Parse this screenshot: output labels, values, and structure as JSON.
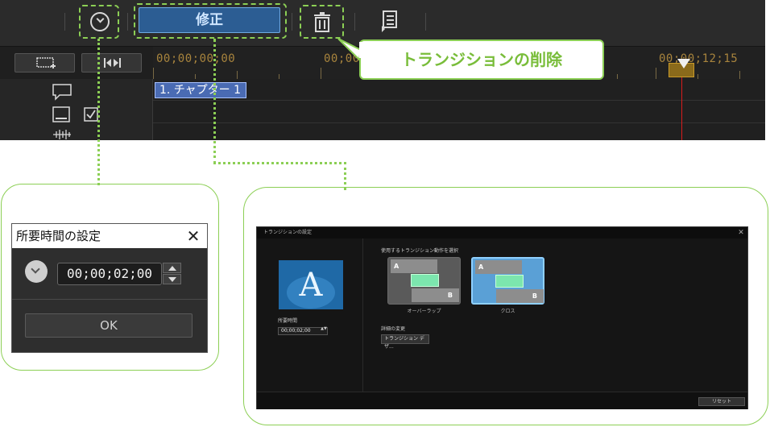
{
  "toolbar": {
    "fix_label": "修正"
  },
  "ruler": {
    "timecodes": [
      "00;00;00;00",
      "00;00",
      "00;00;12;15"
    ]
  },
  "tracks": {
    "chapter_clip": "1. チャプター 1"
  },
  "callout": {
    "text": "トランジションの削除"
  },
  "duration_dialog": {
    "title": "所要時間の設定",
    "close": "✕",
    "value": "00;00;02;00",
    "ok_label": "OK"
  },
  "transition_dialog": {
    "title": "トランジションの設定",
    "close": "✕",
    "preview_letter": "A",
    "duration_label": "所要時間",
    "duration_value": "00;00;02;00",
    "spin": "▲▼",
    "choose_label": "使用するトランジション動作を選択",
    "options": [
      {
        "a": "A",
        "b": "B",
        "label": "オーバーラップ"
      },
      {
        "a": "A",
        "b": "B",
        "label": "クロス"
      }
    ],
    "detail_label": "詳細の変更",
    "design_button": "トランジション デザ...",
    "reset_button": "リセット"
  },
  "colors": {
    "accent_green": "#8ccf55",
    "callout_text": "#79bd3a",
    "fix_button": "#2c5d93",
    "chapter_clip": "#4a6bb3",
    "playhead": "#d81c1c",
    "timecode": "#a8843d"
  },
  "icons": [
    "chevron-circle-icon",
    "trash-icon",
    "chapter-list-icon",
    "speech-bubble-icon",
    "subtitle-icon",
    "checkbox-icon",
    "audio-wave-icon",
    "add-marker-icon",
    "trim-icon",
    "clock-icon",
    "close-icon"
  ]
}
